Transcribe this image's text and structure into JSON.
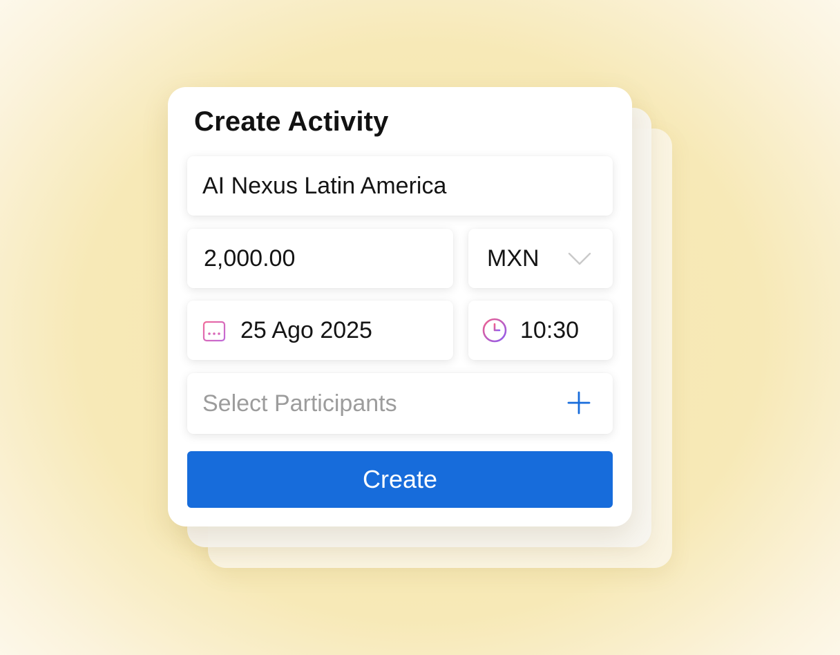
{
  "form": {
    "title": "Create Activity",
    "activity_name": "AI Nexus Latin America",
    "amount": "2,000.00",
    "currency": "MXN",
    "date": "25 Ago 2025",
    "time": "10:30",
    "participants_placeholder": "Select Participants",
    "create_label": "Create"
  },
  "icons": {
    "currency_dropdown": "chevron-down-icon",
    "date": "calendar-icon",
    "time": "clock-icon",
    "add_participant": "plus-icon"
  },
  "colors": {
    "accent": "#176cdb",
    "placeholder": "#9c9c9c",
    "icon_gradient_start": "#f06a9a",
    "icon_gradient_end": "#8d5cf0"
  }
}
